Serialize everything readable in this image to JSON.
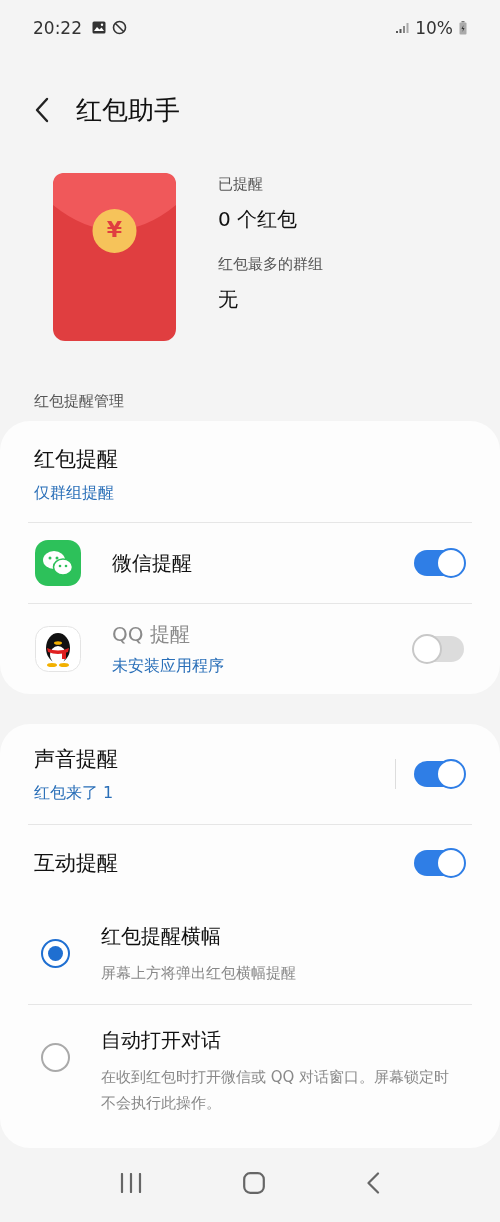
{
  "status_bar": {
    "time": "20:22",
    "battery": "10%"
  },
  "header": {
    "title": "红包助手"
  },
  "summary": {
    "envelope_symbol": "¥",
    "stats": [
      {
        "label": "已提醒",
        "value": "0 个红包"
      },
      {
        "label": "红包最多的群组",
        "value": "无"
      }
    ]
  },
  "section_label": "红包提醒管理",
  "reminder_card": {
    "title": "红包提醒",
    "subtitle": "仅群组提醒",
    "apps": [
      {
        "kind": "wechat",
        "name": "微信提醒",
        "on": true,
        "disabled": false
      },
      {
        "kind": "qq",
        "name": "QQ 提醒",
        "status": "未安装应用程序",
        "on": false,
        "disabled": true
      }
    ]
  },
  "settings_card": {
    "items": [
      {
        "kind": "toggle",
        "title": "声音提醒",
        "subtitle": "红包来了 1",
        "on": true
      },
      {
        "kind": "toggle",
        "title": "互动提醒",
        "on": true
      },
      {
        "kind": "radio",
        "title": "红包提醒横幅",
        "description": "屏幕上方将弹出红包横幅提醒",
        "selected": true
      },
      {
        "kind": "radio",
        "title": "自动打开对话",
        "description": "在收到红包时打开微信或 QQ 对话窗口。屏幕锁定时不会执行此操作。",
        "selected": false
      }
    ]
  }
}
